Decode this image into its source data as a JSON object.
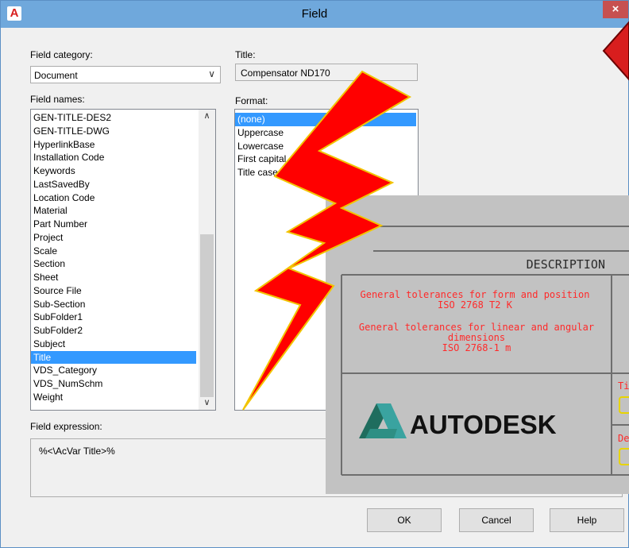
{
  "window": {
    "title": "Field",
    "app_icon_letter": "A",
    "close_glyph": "×"
  },
  "category": {
    "label": "Field category:",
    "value": "Document",
    "arrow": "∨"
  },
  "title_field": {
    "label": "Title:",
    "value": "Compensator ND170"
  },
  "field_names": {
    "label": "Field names:",
    "items": [
      "GEN-TITLE-DES2",
      "GEN-TITLE-DWG",
      "HyperlinkBase",
      "Installation Code",
      "Keywords",
      "LastSavedBy",
      "Location Code",
      "Material",
      "Part Number",
      "Project",
      "Scale",
      "Section",
      "Sheet",
      "Source File",
      "Sub-Section",
      "SubFolder1",
      "SubFolder2",
      "Subject",
      "Title",
      "VDS_Category",
      "VDS_NumSchm",
      "Weight"
    ],
    "selected": "Title",
    "scroll_up": "∧",
    "scroll_down": "∨"
  },
  "format": {
    "label": "Format:",
    "items": [
      "(none)",
      "Uppercase",
      "Lowercase",
      "First capital",
      "Title case"
    ],
    "selected": "(none)"
  },
  "expression": {
    "label": "Field expression:",
    "value": "%<\\AcVar Title>%"
  },
  "buttons": {
    "ok": "OK",
    "cancel": "Cancel",
    "help": "Help"
  },
  "title_block": {
    "header": "DESCRIPTION",
    "tol_form_1": "General tolerances for form and position",
    "tol_form_2": "ISO 2768 T2 K",
    "tol_lin_1": "General tolerances for linear and angular",
    "tol_lin_2": "dimensions",
    "tol_lin_3": "ISO 2768-1 m",
    "logo_text": "AUTODESK",
    "side_label_1": "Ti",
    "side_label_2": "De",
    "text_color": "#ff2a2a",
    "frame_color": "#9b9b9b"
  },
  "colors": {
    "lightning_fill": "#ff0000",
    "lightning_stroke": "#f2c400",
    "selection": "#3399ff",
    "titlebar": "#6fa8dc"
  }
}
